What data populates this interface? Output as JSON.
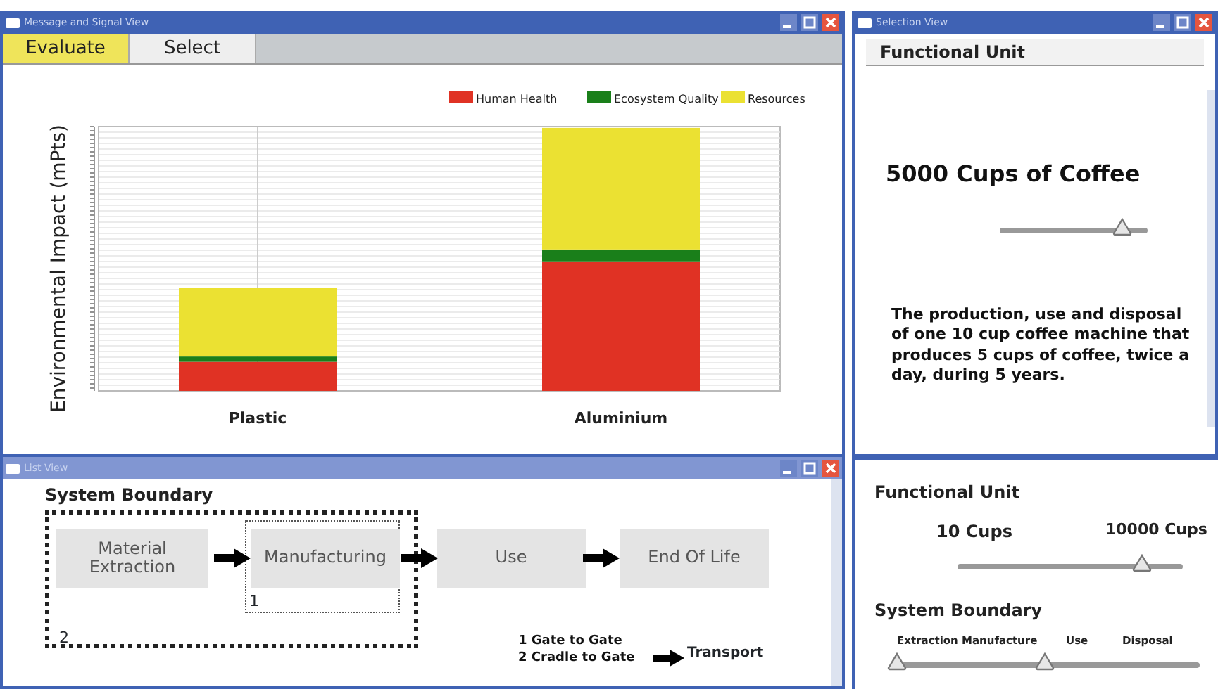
{
  "message_view": {
    "title": "Message and Signal View",
    "tabs": [
      {
        "label": "Evaluate",
        "selected": true
      },
      {
        "label": "Select",
        "selected": false
      }
    ],
    "chart": {
      "ylabel": "Environmental Impact  (mPts)",
      "legend": [
        {
          "label": "Human Health",
          "color": "#e03224"
        },
        {
          "label": "Ecosystem Quality",
          "color": "#1a7f1a"
        },
        {
          "label": "Resources",
          "color": "#ebe132"
        }
      ],
      "categories": [
        "Plastic",
        "Aluminium"
      ]
    }
  },
  "selection_view": {
    "title": "Selection View",
    "heading": "Functional Unit",
    "value": "5000 Cups of Coffee",
    "slider": {
      "level": 0.83
    },
    "description": "The production, use and disposal of one 10 cup coffee machine that produces 5 cups of coffee, twice a day, during 5 years."
  },
  "list_view": {
    "title": "List View",
    "heading": "System Boundary",
    "stages": [
      "Material Extraction",
      "Manufacturing",
      "Use",
      "End Of Life"
    ],
    "boundaries": [
      "1",
      "2"
    ],
    "key": [
      "1 Gate to Gate",
      "2 Cradle to Gate"
    ],
    "transport": "Transport"
  },
  "controls": {
    "functional_unit": {
      "label": "Functional Unit",
      "min": "10 Cups",
      "max": "10000 Cups",
      "slider": {
        "level": 0.82
      }
    },
    "system_boundary": {
      "label": "System Boundary",
      "steps": [
        "Extraction",
        "Manufacture",
        "Use",
        "Disposal"
      ],
      "thumbs": [
        {
          "level": 0
        },
        {
          "level": 0.49
        }
      ]
    }
  }
}
